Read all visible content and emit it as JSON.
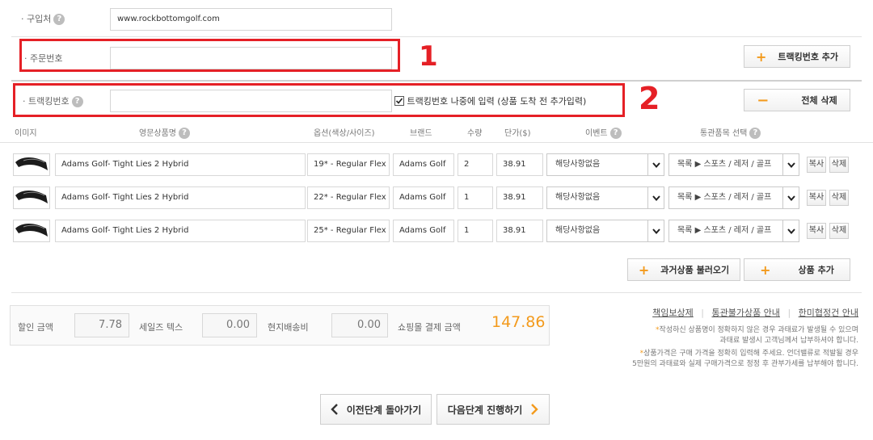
{
  "form": {
    "purchase_site_label": "· 구입처",
    "purchase_site_value": "www.rockbottomgolf.com",
    "order_number_label": "· 주문번호",
    "order_number_value": "",
    "tracking_label": "· 트랙킹번호",
    "tracking_value": "",
    "tracking_later_label": "트랙킹번호 나중에 입력 (상품 도착 전 추가입력)",
    "tracking_later_checked": true,
    "add_tracking_label": "트랙킹번호 추가",
    "delete_all_label": "전체 삭제"
  },
  "annotations": {
    "one": "1",
    "two": "2"
  },
  "table": {
    "headers": {
      "image": "이미지",
      "name": "영문상품명",
      "option": "옵션(색상/사이즈)",
      "brand": "브랜드",
      "qty": "수량",
      "price": "단가($)",
      "event": "이벤트",
      "customs": "통관품목 선택"
    },
    "rows": [
      {
        "name": "Adams Golf- Tight Lies 2 Hybrid",
        "option": "19* - Regular Flex",
        "brand": "Adams Golf",
        "qty": "2",
        "price": "38.91",
        "event": "해당사항없음",
        "customs": "목록 ▶ 스포츠 / 레저 / 골프"
      },
      {
        "name": "Adams Golf- Tight Lies 2 Hybrid",
        "option": "22* - Regular Flex",
        "brand": "Adams Golf",
        "qty": "1",
        "price": "38.91",
        "event": "해당사항없음",
        "customs": "목록 ▶ 스포츠 / 레저 / 골프"
      },
      {
        "name": "Adams Golf- Tight Lies 2 Hybrid",
        "option": "25* - Regular Flex",
        "brand": "Adams Golf",
        "qty": "1",
        "price": "38.91",
        "event": "해당사항없음",
        "customs": "목록 ▶ 스포츠 / 레저 / 골프"
      }
    ],
    "copy_label": "복사",
    "delete_label": "삭제",
    "load_past_label": "과거상품 불러오기",
    "add_product_label": "상품 추가"
  },
  "summary": {
    "discount_label": "할인 금액",
    "discount_value": "7.78",
    "sales_tax_label": "세일즈 텍스",
    "sales_tax_value": "0.00",
    "local_shipping_label": "현지배송비",
    "local_shipping_value": "0.00",
    "total_label": "쇼핑몰 결제 금액",
    "total_value": "147.86"
  },
  "links": {
    "liability": "책임보상제",
    "customs_not_allowed": "통관불가상품 안내",
    "fta": "한미협정건 안내"
  },
  "notes": {
    "note1_line1": "작성하신 상품명이 정확하지 않은 경우 과태료가 발생될 수 있으며",
    "note1_line2": "과태료 발생시 고객님께서 납부하셔야 합니다.",
    "note2_line1": "상품가격은 구매 가격을 정확히 입력해 주세요. 언더밸류로 적발될 경우",
    "note2_line2": "5만원의 과태료와 실제 구매가격으로 정정 후 관부가세를 납부해야 합니다."
  },
  "nav": {
    "prev_label": "이전단계 돌아가기",
    "next_label": "다음단계 진행하기"
  },
  "colors": {
    "accent": "#f39a1c",
    "annotation_red": "#e52026",
    "total_orange": "#f39a1c"
  }
}
